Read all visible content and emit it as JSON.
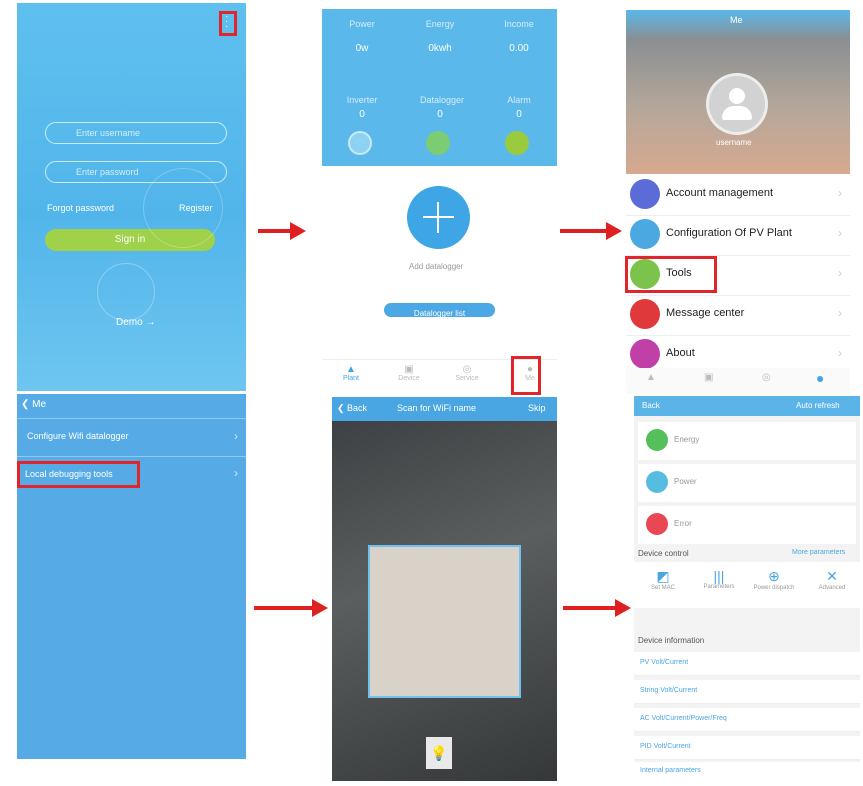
{
  "panel1": {
    "account_placeholder": "Enter username",
    "password_placeholder": "Enter password",
    "forgot": "Forgot password",
    "register": "Register",
    "sign_in": "Sign in",
    "demo": "Demo →"
  },
  "panel2": {
    "stats": [
      {
        "label": "Power",
        "value": "0w"
      },
      {
        "label": "Energy",
        "value": "0kwh"
      },
      {
        "label": "Income",
        "value": "0.00"
      },
      {
        "label": "Inverter",
        "value": "0"
      },
      {
        "label": "Datalogger",
        "value": "0"
      },
      {
        "label": "Alarm",
        "value": "0"
      }
    ],
    "add_label": "Add datalogger",
    "button": "Datalogger list",
    "tabs": [
      "Plant",
      "Device",
      "Service",
      "Me"
    ]
  },
  "panel3": {
    "header": "Me",
    "username": "username",
    "menu": [
      "Account management",
      "Configuration Of PV Plant",
      "Tools",
      "Message center",
      "About"
    ],
    "colors": [
      "#5b6bd8",
      "#4ba8e0",
      "#7bc34b",
      "#e0393b",
      "#c040a8"
    ]
  },
  "panel4": {
    "back": "Me",
    "items": [
      "Configure Wifi datalogger",
      "Local debugging tools"
    ]
  },
  "panel5": {
    "back": "Back",
    "title": "Scan for WiFi name",
    "right": "Skip"
  },
  "panel6": {
    "back": "Back",
    "right": "Auto refresh",
    "cards": [
      "Energy",
      "Power",
      "Error"
    ],
    "device_control": "Device control",
    "more": "More parameters",
    "tools": [
      "Set MAC",
      "Parameters",
      "Power dispatch",
      "Advanced"
    ],
    "device_info": "Device information",
    "rows": [
      "PV Volt/Current",
      "String Volt/Current",
      "AC Volt/Current/Power/Freq",
      "PID Volt/Current",
      "Internal parameters"
    ]
  }
}
